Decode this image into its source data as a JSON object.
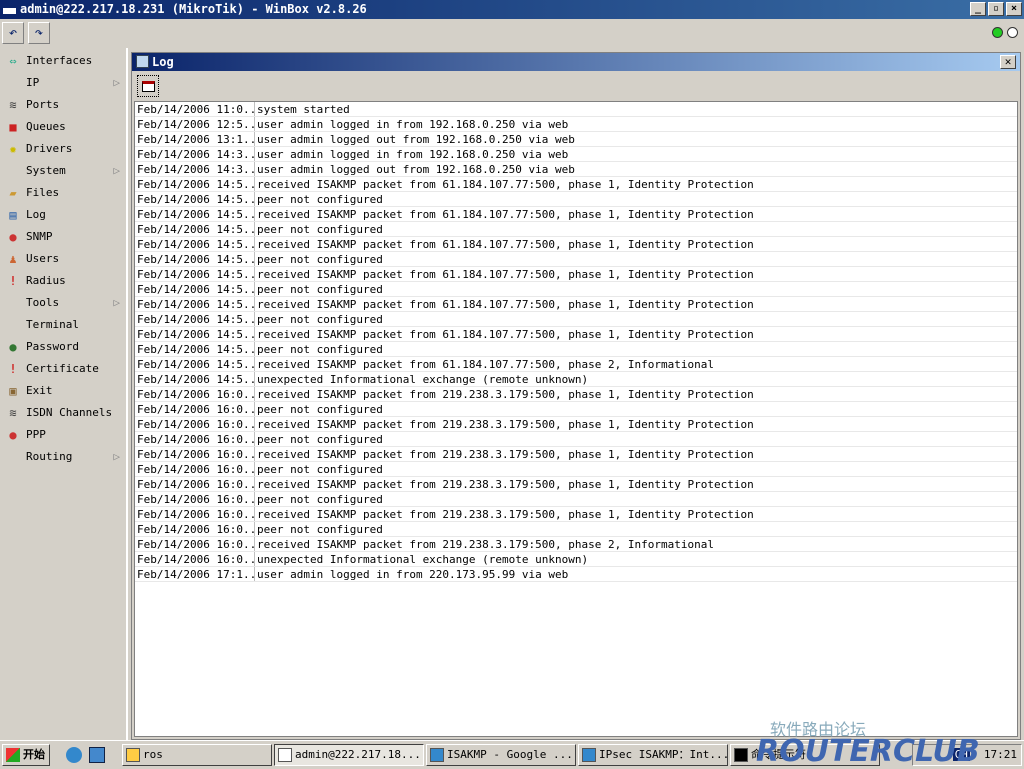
{
  "window": {
    "title": "admin@222.217.18.231 (MikroTik) - WinBox v2.8.26"
  },
  "sidebar": {
    "items": [
      {
        "label": "Interfaces",
        "icon": "interfaces-icon",
        "sub": false
      },
      {
        "label": "IP",
        "icon": "",
        "sub": true
      },
      {
        "label": "Ports",
        "icon": "ports-icon",
        "sub": false
      },
      {
        "label": "Queues",
        "icon": "queues-icon",
        "sub": false
      },
      {
        "label": "Drivers",
        "icon": "drivers-icon",
        "sub": false
      },
      {
        "label": "System",
        "icon": "",
        "sub": true
      },
      {
        "label": "Files",
        "icon": "files-icon",
        "sub": false
      },
      {
        "label": "Log",
        "icon": "log-icon",
        "sub": false
      },
      {
        "label": "SNMP",
        "icon": "snmp-icon",
        "sub": false
      },
      {
        "label": "Users",
        "icon": "users-icon",
        "sub": false
      },
      {
        "label": "Radius",
        "icon": "radius-icon",
        "sub": false
      },
      {
        "label": "Tools",
        "icon": "",
        "sub": true
      },
      {
        "label": "Terminal",
        "icon": "",
        "sub": false
      },
      {
        "label": "Password",
        "icon": "password-icon",
        "sub": false
      },
      {
        "label": "Certificate",
        "icon": "certificate-icon",
        "sub": false
      },
      {
        "label": "Exit",
        "icon": "exit-icon",
        "sub": false
      },
      {
        "label": "ISDN Channels",
        "icon": "isdn-icon",
        "sub": false
      },
      {
        "label": "PPP",
        "icon": "ppp-icon",
        "sub": false
      },
      {
        "label": "Routing",
        "icon": "",
        "sub": true
      }
    ]
  },
  "log": {
    "title": "Log",
    "rows": [
      [
        "Feb/14/2006 11:0...",
        "system started"
      ],
      [
        "Feb/14/2006 12:5...",
        "user admin logged in from 192.168.0.250 via web"
      ],
      [
        "Feb/14/2006 13:1...",
        "user admin logged out from 192.168.0.250 via web"
      ],
      [
        "Feb/14/2006 14:3...",
        "user admin logged in from 192.168.0.250 via web"
      ],
      [
        "Feb/14/2006 14:3...",
        "user admin logged out from 192.168.0.250 via web"
      ],
      [
        "Feb/14/2006 14:5...",
        "received ISAKMP packet from 61.184.107.77:500, phase 1, Identity Protection"
      ],
      [
        "Feb/14/2006 14:5...",
        "peer not configured"
      ],
      [
        "Feb/14/2006 14:5...",
        "received ISAKMP packet from 61.184.107.77:500, phase 1, Identity Protection"
      ],
      [
        "Feb/14/2006 14:5...",
        "peer not configured"
      ],
      [
        "Feb/14/2006 14:5...",
        "received ISAKMP packet from 61.184.107.77:500, phase 1, Identity Protection"
      ],
      [
        "Feb/14/2006 14:5...",
        "peer not configured"
      ],
      [
        "Feb/14/2006 14:5...",
        "received ISAKMP packet from 61.184.107.77:500, phase 1, Identity Protection"
      ],
      [
        "Feb/14/2006 14:5...",
        "peer not configured"
      ],
      [
        "Feb/14/2006 14:5...",
        "received ISAKMP packet from 61.184.107.77:500, phase 1, Identity Protection"
      ],
      [
        "Feb/14/2006 14:5...",
        "peer not configured"
      ],
      [
        "Feb/14/2006 14:5...",
        "received ISAKMP packet from 61.184.107.77:500, phase 1, Identity Protection"
      ],
      [
        "Feb/14/2006 14:5...",
        "peer not configured"
      ],
      [
        "Feb/14/2006 14:5...",
        "received ISAKMP packet from 61.184.107.77:500, phase 2, Informational"
      ],
      [
        "Feb/14/2006 14:5...",
        "unexpected Informational exchange (remote unknown)"
      ],
      [
        "Feb/14/2006 16:0...",
        "received ISAKMP packet from 219.238.3.179:500, phase 1, Identity Protection"
      ],
      [
        "Feb/14/2006 16:0...",
        "peer not configured"
      ],
      [
        "Feb/14/2006 16:0...",
        "received ISAKMP packet from 219.238.3.179:500, phase 1, Identity Protection"
      ],
      [
        "Feb/14/2006 16:0...",
        "peer not configured"
      ],
      [
        "Feb/14/2006 16:0...",
        "received ISAKMP packet from 219.238.3.179:500, phase 1, Identity Protection"
      ],
      [
        "Feb/14/2006 16:0...",
        "peer not configured"
      ],
      [
        "Feb/14/2006 16:0...",
        "received ISAKMP packet from 219.238.3.179:500, phase 1, Identity Protection"
      ],
      [
        "Feb/14/2006 16:0...",
        "peer not configured"
      ],
      [
        "Feb/14/2006 16:0...",
        "received ISAKMP packet from 219.238.3.179:500, phase 1, Identity Protection"
      ],
      [
        "Feb/14/2006 16:0...",
        "peer not configured"
      ],
      [
        "Feb/14/2006 16:0...",
        "received ISAKMP packet from 219.238.3.179:500, phase 2, Informational"
      ],
      [
        "Feb/14/2006 16:0...",
        "unexpected Informational exchange (remote unknown)"
      ],
      [
        "Feb/14/2006 17:1...",
        "user admin logged in from 220.173.95.99 via web"
      ]
    ]
  },
  "taskbar": {
    "start": "开始",
    "tasks": [
      "ros",
      "admin@222.217.18....",
      "ISAKMP - Google ...",
      "IPsec ISAKMP：Int...",
      "命令提示符"
    ],
    "tray_lang": "CH",
    "clock": "17:21"
  },
  "watermark": {
    "text": "软件路由论坛",
    "logo": "ROUTERCLUB"
  }
}
